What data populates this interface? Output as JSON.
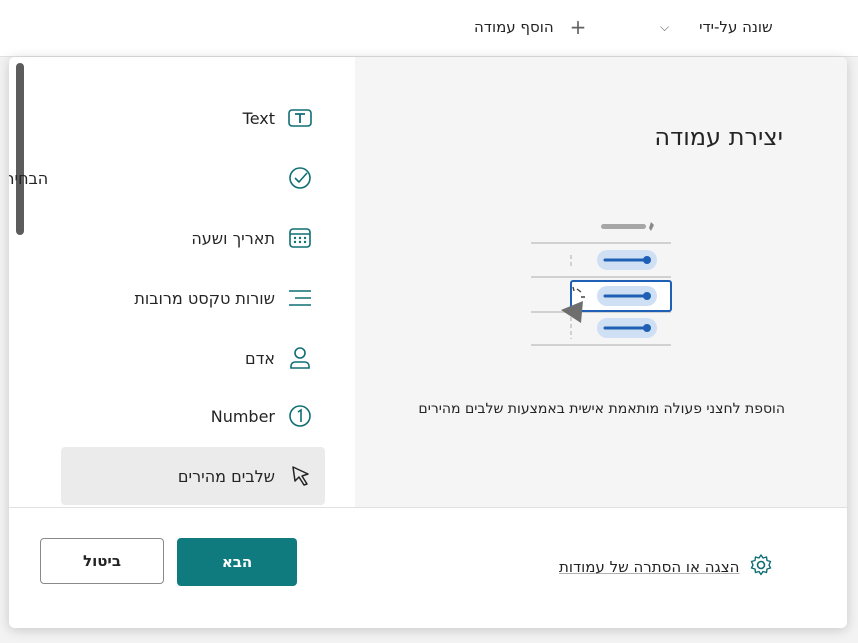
{
  "topbar": {
    "add_column_label": "הוסף עמודה",
    "modified_by_label": "שונה על-ידי"
  },
  "column_types": [
    {
      "label": "Text",
      "icon": "text-box-icon"
    },
    {
      "label": "הבחירה",
      "icon": "choice-icon"
    },
    {
      "label": "תאריך ושעה",
      "icon": "calendar-icon"
    },
    {
      "label": "שורות טקסט מרובות",
      "icon": "multiline-text-icon"
    },
    {
      "label": "אדם",
      "icon": "person-icon"
    },
    {
      "label": "Number",
      "icon": "number-icon"
    },
    {
      "label": "שלבים מהירים",
      "icon": "quick-steps-icon",
      "selected": true
    }
  ],
  "preview": {
    "title": "יצירת עמודה",
    "description": "הוספת לחצני פעולה מותאמת אישית באמצעות שלבים מהירים"
  },
  "footer": {
    "show_hide_label": "הצגה או הסתרה של עמודות",
    "next_label": "הבא",
    "cancel_label": "ביטול"
  },
  "colors": {
    "accent": "#0f7b7f",
    "selected_bg": "#ebebeb",
    "illustration_blue": "#1f5fb5"
  }
}
